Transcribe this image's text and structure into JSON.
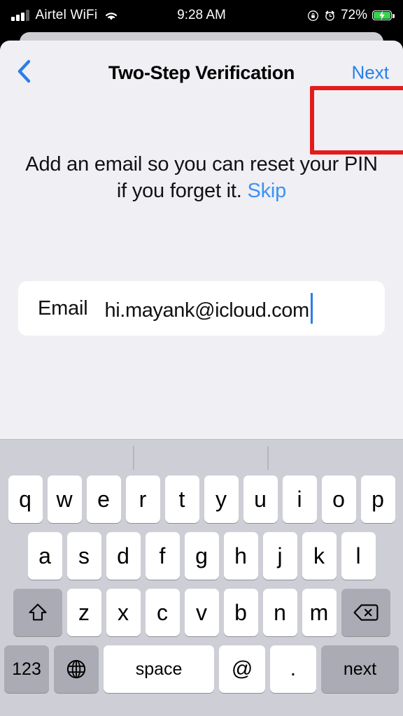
{
  "status_bar": {
    "carrier": "Airtel WiFi",
    "time": "9:28 AM",
    "battery_percent": "72%",
    "icons": {
      "signal": "signal-bars-icon",
      "wifi": "wifi-icon",
      "rotation_lock": "rotation-lock-icon",
      "alarm": "alarm-clock-icon",
      "battery": "battery-charging-icon"
    }
  },
  "nav": {
    "back_icon": "chevron-left-icon",
    "title": "Two-Step Verification",
    "next_label": "Next"
  },
  "annotation": {
    "color": "#e41b1b",
    "target": "next-button"
  },
  "content": {
    "description": "Add an email so you can reset your ",
    "description_line2": "PIN if you forget it. ",
    "skip_label": "Skip",
    "email_label": "Email",
    "email_value": "hi.mayank@icloud.com",
    "email_placeholder": "Email"
  },
  "keyboard": {
    "suggestions": [
      "",
      "",
      ""
    ],
    "row1": [
      "q",
      "w",
      "e",
      "r",
      "t",
      "y",
      "u",
      "i",
      "o",
      "p"
    ],
    "row2": [
      "a",
      "s",
      "d",
      "f",
      "g",
      "h",
      "j",
      "k",
      "l"
    ],
    "row3": [
      "z",
      "x",
      "c",
      "v",
      "b",
      "n",
      "m"
    ],
    "shift_icon": "shift-arrow-icon",
    "backspace_icon": "backspace-delete-icon",
    "numbers_label": "123",
    "globe_icon": "globe-icon",
    "space_label": "space",
    "at_label": "@",
    "dot_label": ".",
    "return_label": "next"
  },
  "colors": {
    "accent_blue": "#2a7fe8",
    "link_blue": "#3b93f2",
    "screen_bg": "#f0eff4",
    "keyboard_bg": "#cdced6",
    "annotation_red": "#e41b1b",
    "battery_green": "#3ad152"
  }
}
